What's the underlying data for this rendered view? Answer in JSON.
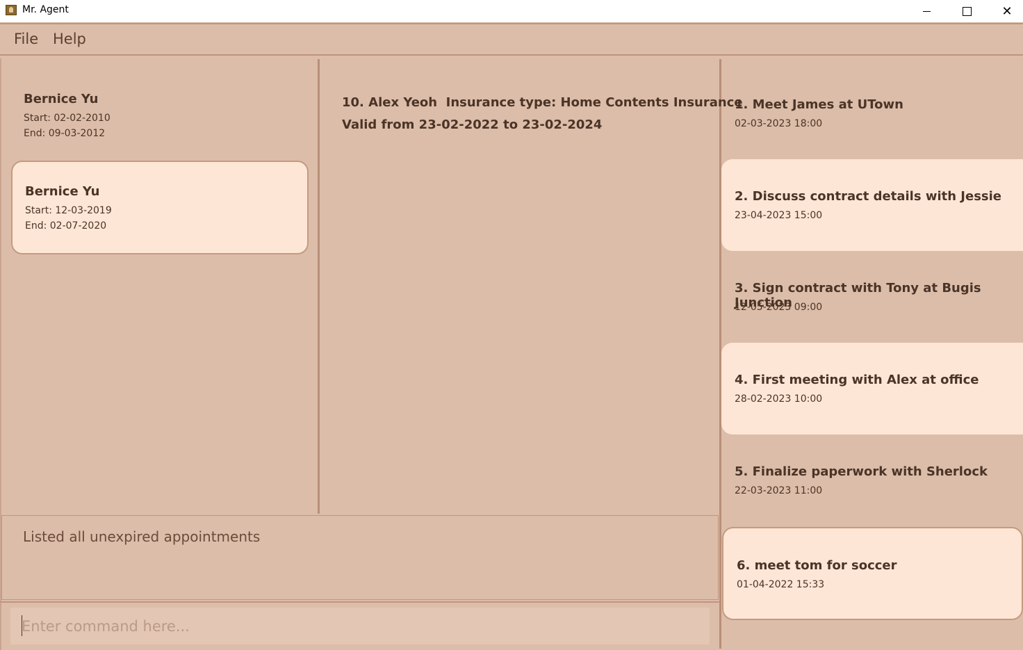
{
  "window": {
    "title": "Mr. Agent",
    "controls": {
      "minimize": "minimize-icon",
      "maximize": "maximize-icon",
      "close": "close-icon"
    }
  },
  "menu": {
    "file": "File",
    "help": "Help"
  },
  "policies": [
    {
      "name": "Bernice Yu",
      "start": "Start: 02-02-2010",
      "end": "End: 09-03-2012",
      "selected": false
    },
    {
      "name": "Bernice Yu",
      "start": "Start: 12-03-2019",
      "end": "End: 02-07-2020",
      "selected": true
    }
  ],
  "client_detail": {
    "line1": "10. Alex Yeoh  Insurance type: Home Contents Insurance",
    "line2": "Valid from 23-02-2022 to 23-02-2024"
  },
  "appointments": [
    {
      "title": "1. Meet James at UTown",
      "time": "02-03-2023 18:00"
    },
    {
      "title": "2. Discuss contract details with Jessie",
      "time": "23-04-2023 15:00"
    },
    {
      "title": "3. Sign contract with Tony at Bugis Junction",
      "time": "12-05-2023 09:00"
    },
    {
      "title": "4. First meeting with Alex at office",
      "time": "28-02-2023 10:00"
    },
    {
      "title": "5. Finalize paperwork with Sherlock",
      "time": "22-03-2023 11:00"
    },
    {
      "title": "6. meet tom for soccer",
      "time": "01-04-2022 15:33"
    }
  ],
  "result": {
    "text": "Listed all unexpired appointments"
  },
  "command": {
    "placeholder": "Enter command here...",
    "value": ""
  },
  "colors": {
    "background": "#dcbda9",
    "card": "#fde6d6",
    "border": "#c1947c",
    "text": "#4a3427"
  }
}
